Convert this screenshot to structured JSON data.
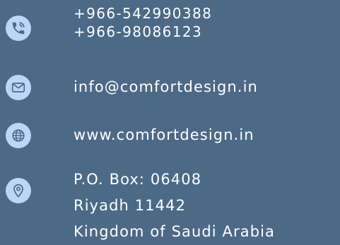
{
  "contact": {
    "phones": [
      "+966-542990388",
      "+966-98086123"
    ],
    "email": "info@comfortdesign.in",
    "website": "www.comfortdesign.in",
    "address": [
      "P.O. Box: 06408",
      "Riyadh 11442",
      "Kingdom of Saudi Arabia"
    ]
  },
  "icons": {
    "phone": "phone-icon",
    "email": "envelope-icon",
    "website": "globe-icon",
    "address": "map-pin-icon"
  },
  "colors": {
    "background": "#4c6a85",
    "icon_circle": "#b9d8f7",
    "icon_glyph": "#4c6a85",
    "text": "#ffffff"
  }
}
